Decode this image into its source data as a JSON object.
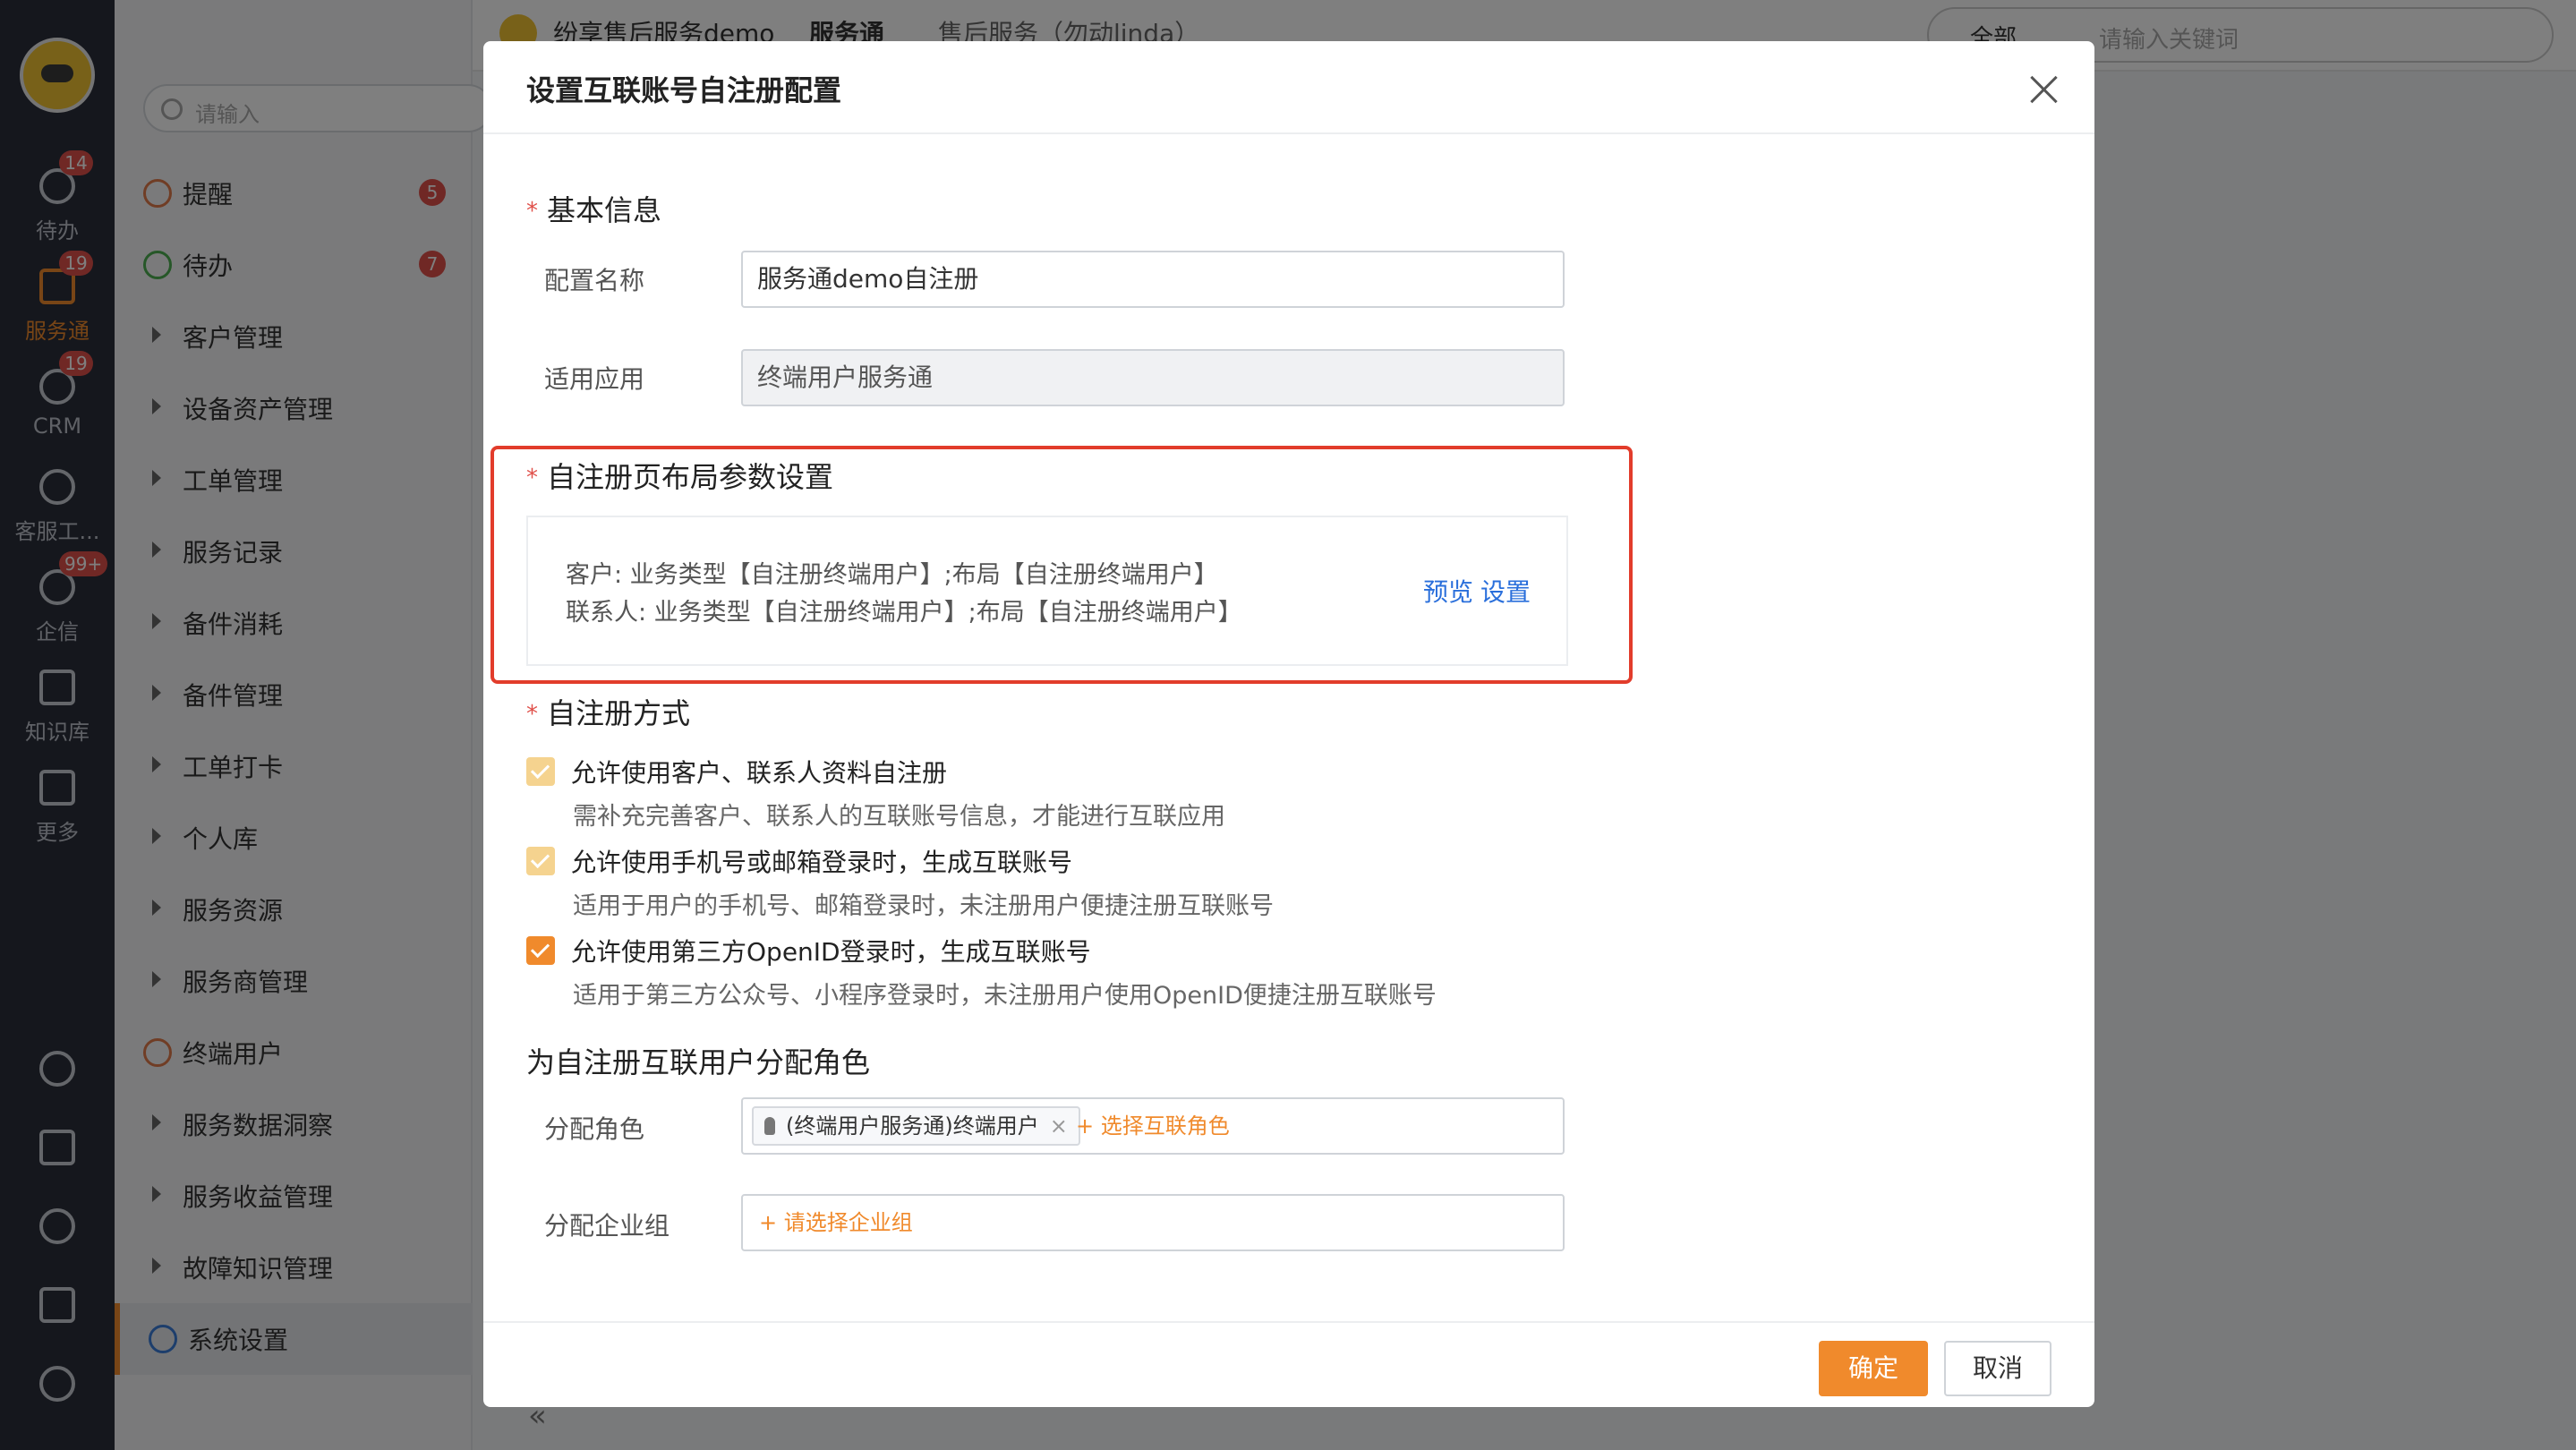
{
  "rail": {
    "items": [
      {
        "label": "待办",
        "badge": "14",
        "icon": "check-circle-icon"
      },
      {
        "label": "服务通",
        "badge": "19",
        "icon": "service-icon"
      },
      {
        "label": "CRM",
        "badge": "19",
        "icon": "pie-chart-icon"
      },
      {
        "label": "客服工...",
        "badge": "",
        "icon": "headset-icon"
      },
      {
        "label": "企信",
        "badge": "99+",
        "icon": "chat-icon"
      },
      {
        "label": "知识库",
        "badge": "",
        "icon": "book-icon"
      },
      {
        "label": "更多",
        "badge": "",
        "icon": "grid-icon"
      }
    ],
    "bottom_icons": [
      "help-icon",
      "notes-icon",
      "clock-icon",
      "contacts-icon",
      "settings-icon"
    ]
  },
  "sidebar": {
    "search_placeholder": "请输入",
    "items": [
      {
        "label": "提醒",
        "badge": "5"
      },
      {
        "label": "待办",
        "badge": "7"
      },
      {
        "label": "客户管理"
      },
      {
        "label": "设备资产管理"
      },
      {
        "label": "工单管理"
      },
      {
        "label": "服务记录"
      },
      {
        "label": "备件消耗"
      },
      {
        "label": "备件管理"
      },
      {
        "label": "工单打卡"
      },
      {
        "label": "个人库"
      },
      {
        "label": "服务资源"
      },
      {
        "label": "服务商管理"
      },
      {
        "label": "终端用户"
      },
      {
        "label": "服务数据洞察"
      },
      {
        "label": "服务收益管理"
      },
      {
        "label": "故障知识管理"
      },
      {
        "label": "系统设置"
      }
    ],
    "collapse_glyph": "«"
  },
  "topbar": {
    "company": "纷享售后服务demo",
    "app": "服务通",
    "view": "售后服务（勿动linda）",
    "search_scope": "全部",
    "search_placeholder": "请输入关键词"
  },
  "modal": {
    "title": "设置互联账号自注册配置",
    "basic_section": "基本信息",
    "config_name_label": "配置名称",
    "config_name_value": "服务通demo自注册",
    "app_label": "适用应用",
    "app_value": "终端用户服务通",
    "layout_section": "自注册页布局参数设置",
    "layout_line1": "客户: 业务类型【自注册终端用户】;布局【自注册终端用户】",
    "layout_line2": "联系人: 业务类型【自注册终端用户】;布局【自注册终端用户】",
    "preview_link": "预览",
    "settings_link": "设置",
    "method_section": "自注册方式",
    "options": [
      {
        "label": "允许使用客户、联系人资料自注册",
        "desc": "需补充完善客户、联系人的互联账号信息，才能进行互联应用",
        "checked": true
      },
      {
        "label": "允许使用手机号或邮箱登录时，生成互联账号",
        "desc": "适用于用户的手机号、邮箱登录时，未注册用户便捷注册互联账号",
        "checked": true
      },
      {
        "label": "允许使用第三方OpenID登录时，生成互联账号",
        "desc": "适用于第三方公众号、小程序登录时，未注册用户使用OpenID便捷注册互联账号",
        "checked": true
      }
    ],
    "role_section": "为自注册互联用户分配角色",
    "role_label": "分配角色",
    "role_tag": "(终端用户服务通)终端用户",
    "role_add": "+ 选择互联角色",
    "group_label": "分配企业组",
    "group_add": "+ 请选择企业组",
    "ok": "确定",
    "cancel": "取消"
  },
  "colors": {
    "accent": "#f08a2c",
    "link": "#2a6fdb",
    "highlight": "#e23c2b",
    "badge": "#e0504a",
    "rail_bg": "#2b2f3a"
  }
}
